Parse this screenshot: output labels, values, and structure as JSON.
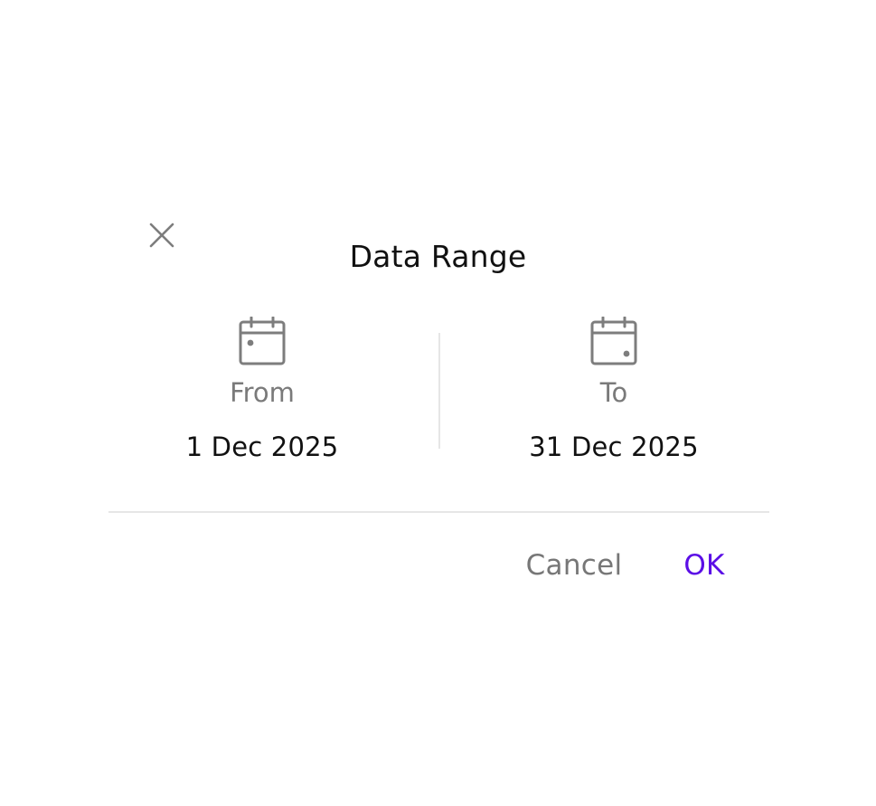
{
  "dialog": {
    "title": "Data Range",
    "close_icon": "close-icon",
    "from": {
      "icon": "calendar-start-icon",
      "label": "From",
      "date": "1 Dec 2025"
    },
    "to": {
      "icon": "calendar-end-icon",
      "label": "To",
      "date": "31 Dec 2025"
    },
    "actions": {
      "cancel_label": "Cancel",
      "ok_label": "OK"
    }
  },
  "colors": {
    "accent": "#5b0ee6",
    "muted_text": "#7a7a7a",
    "primary_text": "#111111",
    "icon": "#7d7d7d",
    "divider": "#e6e6e6"
  }
}
